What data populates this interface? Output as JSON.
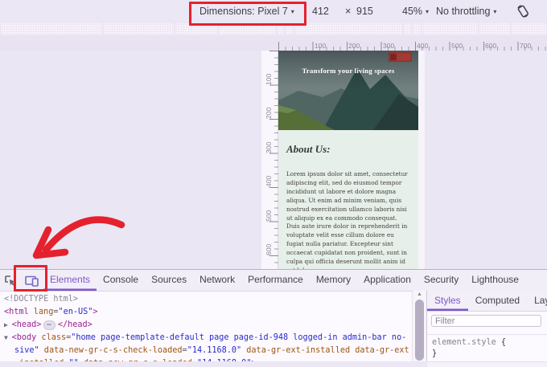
{
  "device_toolbar": {
    "dimensions_label": "Dimensions: Pixel 7",
    "width_value": "412",
    "multiply_sign": "×",
    "height_value": "915",
    "zoom_value": "45%",
    "throttling_value": "No throttling",
    "dropdown_caret": "▾"
  },
  "rulers": {
    "horizontal": [
      "100",
      "200",
      "300",
      "400",
      "500",
      "600",
      "700"
    ],
    "vertical": [
      "100",
      "200",
      "300",
      "400",
      "500",
      "600"
    ]
  },
  "device_page": {
    "hero_title": "Transform your living spaces",
    "about_heading": "About Us:",
    "about_paragraph": "Lorem ipsum dolor sit amet, consectetur adipiscing elit, sed do eiusmod tempor incididunt ut labore et dolore magna aliqua. Ut enim ad minim veniam, quis nostrud exercitation ullamco laboris nisi ut aliquip ex ea commodo consequat. Duis aute irure dolor in reprehenderit in voluptate velit esse cillum dolore eu fugiat nulla pariatur. Excepteur sint occaecat cupidatat non proident, sunt in culpa qui officia deserunt mollit anim id est laborum."
  },
  "panel": {
    "tabs": [
      {
        "label": "Elements",
        "active": true
      },
      {
        "label": "Console"
      },
      {
        "label": "Sources"
      },
      {
        "label": "Network"
      },
      {
        "label": "Performance"
      },
      {
        "label": "Memory"
      },
      {
        "label": "Application"
      },
      {
        "label": "Security"
      },
      {
        "label": "Lighthouse"
      }
    ],
    "scroll_up_glyph": "▲",
    "code_lines": [
      {
        "indent": false,
        "tokens": [
          {
            "c": "gray",
            "t": "<!DOCTYPE html>"
          }
        ]
      },
      {
        "indent": false,
        "tokens": [
          {
            "c": "tag",
            "t": "<html"
          },
          {
            "c": "attr",
            "t": " lang"
          },
          {
            "c": "eq",
            "t": "="
          },
          {
            "c": "val",
            "t": "\"en-US\""
          },
          {
            "c": "tag",
            "t": ">"
          }
        ]
      },
      {
        "indent": false,
        "tokens": [
          {
            "c": "arrow",
            "t": "▶ "
          },
          {
            "c": "tag",
            "t": "<head>"
          },
          {
            "c": "ellipsis",
            "t": "⋯"
          },
          {
            "c": "tag",
            "t": "</head>"
          }
        ]
      },
      {
        "indent": false,
        "tokens": [
          {
            "c": "arrow",
            "t": "▼ "
          },
          {
            "c": "tag",
            "t": "<body"
          },
          {
            "c": "attr",
            "t": " class"
          },
          {
            "c": "eq",
            "t": "="
          },
          {
            "c": "val",
            "t": "\"home page-template-default page page-id-948 logged-in admin-bar no-"
          }
        ]
      },
      {
        "indent": true,
        "tokens": [
          {
            "c": "val",
            "t": "sive\""
          },
          {
            "c": "attr",
            "t": " data-new-gr-c-s-check-loaded"
          },
          {
            "c": "eq",
            "t": "="
          },
          {
            "c": "val",
            "t": "\"14.1168.0\""
          },
          {
            "c": "attr",
            "t": " data-gr-ext-installed"
          },
          {
            "c": "attr",
            "t": " data-gr-ext"
          }
        ]
      },
      {
        "indent": true,
        "tokens": [
          {
            "c": "attr",
            "t": "-installed"
          },
          {
            "c": "eq",
            "t": "="
          },
          {
            "c": "val",
            "t": "\"\""
          },
          {
            "c": "attr",
            "t": " data-new-gr-c-s-loaded"
          },
          {
            "c": "eq",
            "t": "="
          },
          {
            "c": "val",
            "t": "\"14.1168.0\""
          },
          {
            "c": "tag",
            "t": ">"
          }
        ]
      }
    ],
    "styles_pane": {
      "tabs": [
        {
          "label": "Styles",
          "active": true
        },
        {
          "label": "Computed"
        },
        {
          "label": "Layout"
        }
      ],
      "filter_placeholder": "Filter",
      "rule_selector": "element.style",
      "open_brace": "{",
      "close_brace": "}"
    }
  },
  "colors": {
    "annotation_red": "#e5212e",
    "accent_purple": "#7e57c8",
    "about_bg_mint": "#e6efe9",
    "menu_button_red": "#a23a34",
    "hero_teal": "#31504a"
  }
}
